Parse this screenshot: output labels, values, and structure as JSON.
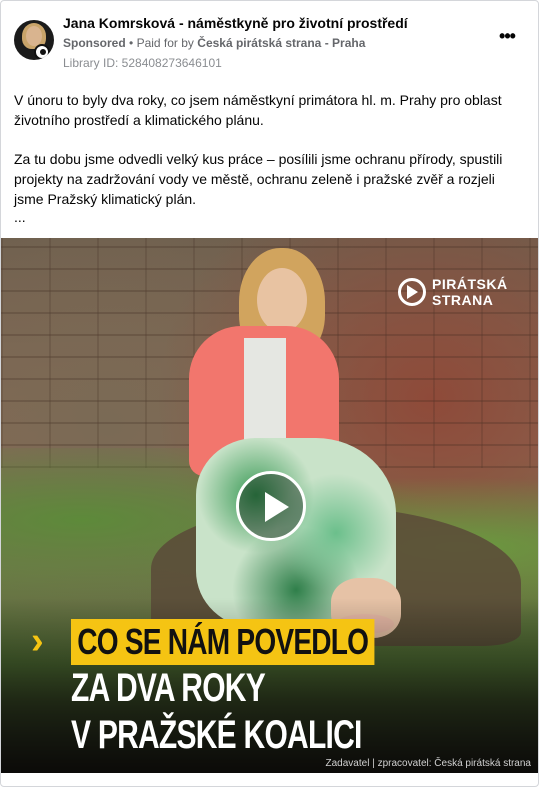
{
  "post": {
    "author": "Jana Komrsková - náměstkyně pro životní prostředí",
    "sponsored_label": "Sponsored",
    "paid_for_prefix": "Paid for by",
    "paid_for_by": "Česká pirátská strana - Praha",
    "library_id": "Library ID: 528408273646101",
    "more_icon": "more-options-icon",
    "paragraphs": [
      "V únoru to byly dva roky, co jsem náměstkyní primátora hl. m. Prahy pro oblast životního prostředí a klimatického plánu.",
      "Za tu dobu jsme odvedli velký kus práce – posílili jsme ochranu přírody, spustili projekty na zadržování vody ve městě, ochranu zeleně i pražské zvěř a rozjeli jsme Pražský klimatický plán."
    ],
    "ellipsis": "..."
  },
  "video": {
    "play_icon": "play-icon",
    "logo_line1": "PIRÁTSKÁ",
    "logo_line2": "STRANA",
    "arrow": "›",
    "headline_line1": "CO SE NÁM POVEDLO",
    "headline_line2": "ZA DVA ROKY",
    "headline_line3": "V PRAŽSKÉ KOALICI",
    "credit": "Zadavatel | zpracovatel: Česká pirátská strana",
    "accent_color": "#f5c413"
  }
}
